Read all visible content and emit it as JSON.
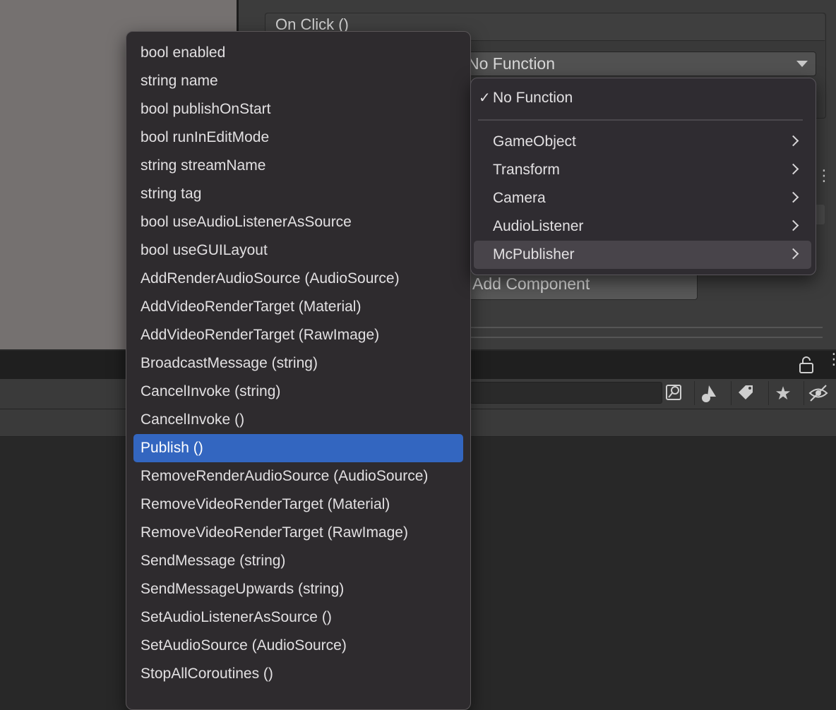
{
  "inspector": {
    "onclick_label": "On Click ()",
    "function_dropdown_value": "No Function",
    "add_component_label": "Add Component"
  },
  "left_menu": {
    "items": [
      {
        "label": "bool enabled"
      },
      {
        "label": "string name"
      },
      {
        "label": "bool publishOnStart"
      },
      {
        "label": "bool runInEditMode"
      },
      {
        "label": "string streamName"
      },
      {
        "label": "string tag"
      },
      {
        "label": "bool useAudioListenerAsSource"
      },
      {
        "label": "bool useGUILayout"
      },
      {
        "label": "AddRenderAudioSource (AudioSource)"
      },
      {
        "label": "AddVideoRenderTarget (Material)"
      },
      {
        "label": "AddVideoRenderTarget (RawImage)"
      },
      {
        "label": "BroadcastMessage (string)"
      },
      {
        "label": "CancelInvoke (string)"
      },
      {
        "label": "CancelInvoke ()"
      },
      {
        "label": "Publish ()"
      },
      {
        "label": "RemoveRenderAudioSource (AudioSource)"
      },
      {
        "label": "RemoveVideoRenderTarget (Material)"
      },
      {
        "label": "RemoveVideoRenderTarget (RawImage)"
      },
      {
        "label": "SendMessage (string)"
      },
      {
        "label": "SendMessageUpwards (string)"
      },
      {
        "label": "SetAudioListenerAsSource ()"
      },
      {
        "label": "SetAudioSource (AudioSource)"
      },
      {
        "label": "StopAllCoroutines ()"
      }
    ],
    "selected_index": 14
  },
  "right_menu": {
    "checked_label": "No Function",
    "check_glyph": "✓",
    "items": [
      {
        "label": "GameObject"
      },
      {
        "label": "Transform"
      },
      {
        "label": "Camera"
      },
      {
        "label": "AudioListener"
      },
      {
        "label": "McPublisher"
      }
    ],
    "highlighted_index": 4
  },
  "colors": {
    "selection": "#3366c0",
    "menu_bg": "#2e2b2e",
    "hover_bg": "#48444a"
  }
}
